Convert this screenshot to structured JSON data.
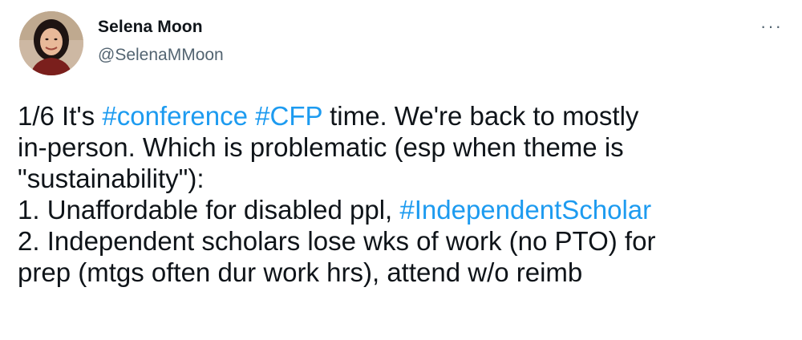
{
  "author": {
    "name": "Selena Moon",
    "handle": "@SelenaMMoon",
    "avatar_icon": "avatar-photo"
  },
  "menu": {
    "more_label": "···",
    "icon": "more-horizontal-icon"
  },
  "colors": {
    "hashtag": "#1d9bf0",
    "text": "#0f1419",
    "muted": "#536471"
  },
  "tweet": {
    "line1_pre": "1/6 It's ",
    "hashtag1": "#conference",
    "space1": " ",
    "hashtag2": "#CFP",
    "line1_post": " time. We're back to mostly",
    "line2": "in-person. Which is problematic (esp when theme is",
    "line3": "\"sustainability\"):",
    "line4_pre": "1. Unaffordable for disabled ppl, ",
    "hashtag3": "#IndependentScholar",
    "line5": "2. Independent scholars lose wks of work (no PTO) for",
    "line6": "prep (mtgs often dur work hrs), attend w/o reimb"
  }
}
